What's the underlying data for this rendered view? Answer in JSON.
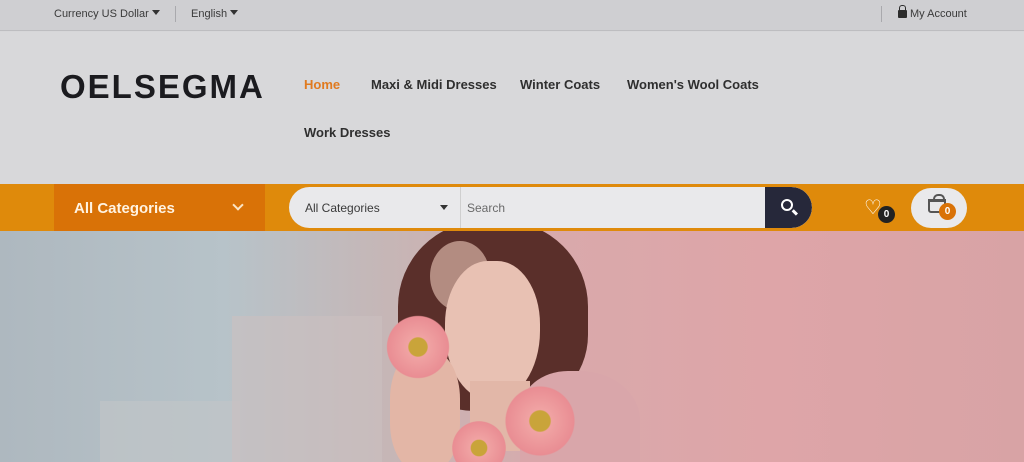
{
  "topbar": {
    "currency": "Currency US Dollar",
    "language": "English",
    "account": "My Account"
  },
  "header": {
    "logo": "OELSEGMA",
    "nav": [
      "Home",
      "Maxi & Midi Dresses",
      "Winter Coats",
      "Women's Wool Coats",
      "Work Dresses"
    ],
    "active_nav": "Home"
  },
  "categories_bar": {
    "label": "All Categories"
  },
  "search": {
    "category_selected": "All Categories",
    "placeholder": "Search"
  },
  "wishlist": {
    "count": "0"
  },
  "cart": {
    "count": "0"
  },
  "colors": {
    "accent_orange": "#df8a0b",
    "nav_active": "#e07a1f",
    "search_button": "#26283a"
  }
}
